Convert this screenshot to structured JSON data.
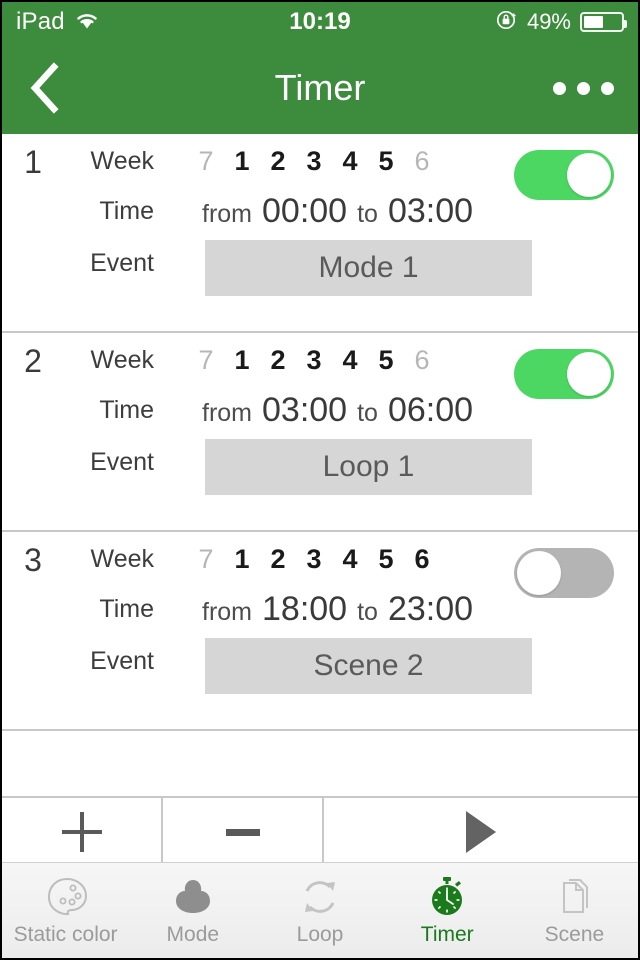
{
  "status_bar": {
    "device": "iPad",
    "wifi_icon": "wifi-icon",
    "time": "10:19",
    "rotation_lock_icon": "rotation-lock-icon",
    "battery_percent": "49%",
    "battery_level": 49
  },
  "nav_bar": {
    "back_icon": "chevron-left-icon",
    "title": "Timer",
    "more_icon": "more-options-icon"
  },
  "labels": {
    "week": "Week",
    "time": "Time",
    "event": "Event",
    "from": "from",
    "to": "to"
  },
  "week_day_order": [
    "7",
    "1",
    "2",
    "3",
    "4",
    "5",
    "6"
  ],
  "timers": [
    {
      "index": "1",
      "days": [
        {
          "label": "7",
          "active": false
        },
        {
          "label": "1",
          "active": true
        },
        {
          "label": "2",
          "active": true
        },
        {
          "label": "3",
          "active": true
        },
        {
          "label": "4",
          "active": true
        },
        {
          "label": "5",
          "active": true
        },
        {
          "label": "6",
          "active": false
        }
      ],
      "from": "00:00",
      "to": "03:00",
      "event": "Mode 1",
      "enabled": true
    },
    {
      "index": "2",
      "days": [
        {
          "label": "7",
          "active": false
        },
        {
          "label": "1",
          "active": true
        },
        {
          "label": "2",
          "active": true
        },
        {
          "label": "3",
          "active": true
        },
        {
          "label": "4",
          "active": true
        },
        {
          "label": "5",
          "active": true
        },
        {
          "label": "6",
          "active": false
        }
      ],
      "from": "03:00",
      "to": "06:00",
      "event": "Loop 1",
      "enabled": true
    },
    {
      "index": "3",
      "days": [
        {
          "label": "7",
          "active": false
        },
        {
          "label": "1",
          "active": true
        },
        {
          "label": "2",
          "active": true
        },
        {
          "label": "3",
          "active": true
        },
        {
          "label": "4",
          "active": true
        },
        {
          "label": "5",
          "active": true
        },
        {
          "label": "6",
          "active": true
        }
      ],
      "from": "18:00",
      "to": "23:00",
      "event": "Scene 2",
      "enabled": false
    }
  ],
  "control_bar": {
    "add_icon": "plus-icon",
    "remove_icon": "minus-icon",
    "play_icon": "play-icon"
  },
  "tab_bar": {
    "items": [
      {
        "label": "Static color",
        "icon": "palette-icon",
        "active": false
      },
      {
        "label": "Mode",
        "icon": "mode-blob-icon",
        "active": false
      },
      {
        "label": "Loop",
        "icon": "loop-refresh-icon",
        "active": false
      },
      {
        "label": "Timer",
        "icon": "stopwatch-icon",
        "active": true
      },
      {
        "label": "Scene",
        "icon": "pages-icon",
        "active": false
      }
    ]
  },
  "colors": {
    "header_green": "#3d8b3d",
    "toggle_on": "#4cd763",
    "toggle_off": "#b4b4b4",
    "event_box": "#d6d6d6",
    "active_tab": "#1b7a1b"
  }
}
